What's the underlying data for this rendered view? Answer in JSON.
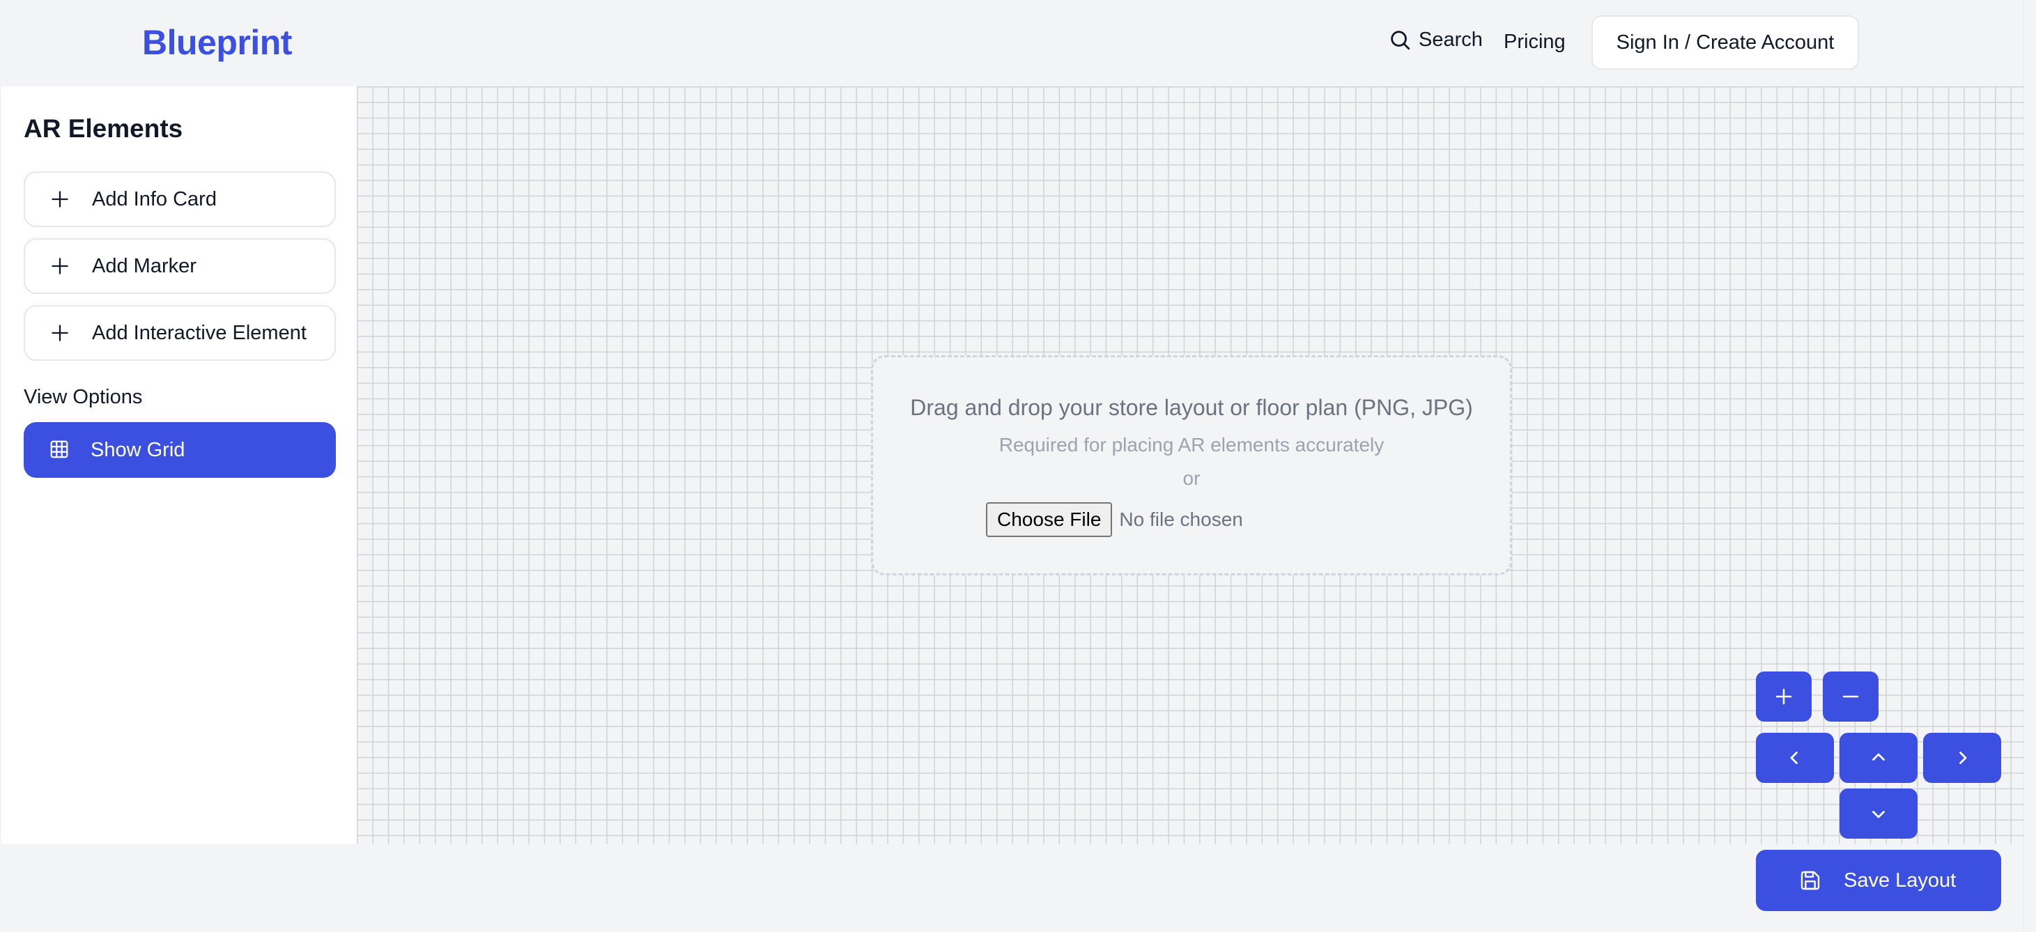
{
  "header": {
    "logo": "Blueprint",
    "search_label": "Search",
    "pricing_label": "Pricing",
    "signin_label": "Sign In / Create Account"
  },
  "sidebar": {
    "title": "AR Elements",
    "buttons": [
      {
        "label": "Add Info Card",
        "icon": "plus-icon"
      },
      {
        "label": "Add Marker",
        "icon": "plus-icon"
      },
      {
        "label": "Add Interactive Element",
        "icon": "plus-icon"
      }
    ],
    "view_options_title": "View Options",
    "show_grid_label": "Show Grid",
    "show_grid_icon": "grid-icon"
  },
  "dropzone": {
    "main_text": "Drag and drop your store layout or floor plan (PNG, JPG)",
    "sub_text": "Required for placing AR elements accurately",
    "or_text": "or",
    "choose_file_label": "Choose File",
    "file_status": "No file chosen"
  },
  "controls": {
    "zoom_in_icon": "plus-icon",
    "zoom_out_icon": "minus-icon",
    "pan_left_icon": "chevron-left-icon",
    "pan_up_icon": "chevron-up-icon",
    "pan_right_icon": "chevron-right-icon",
    "pan_down_icon": "chevron-down-icon"
  },
  "save": {
    "label": "Save Layout",
    "icon": "save-icon"
  },
  "colors": {
    "accent": "#3b4fe0",
    "background": "#f3f4f6",
    "panel": "#ffffff",
    "grid_line": "#cfd2d7"
  }
}
